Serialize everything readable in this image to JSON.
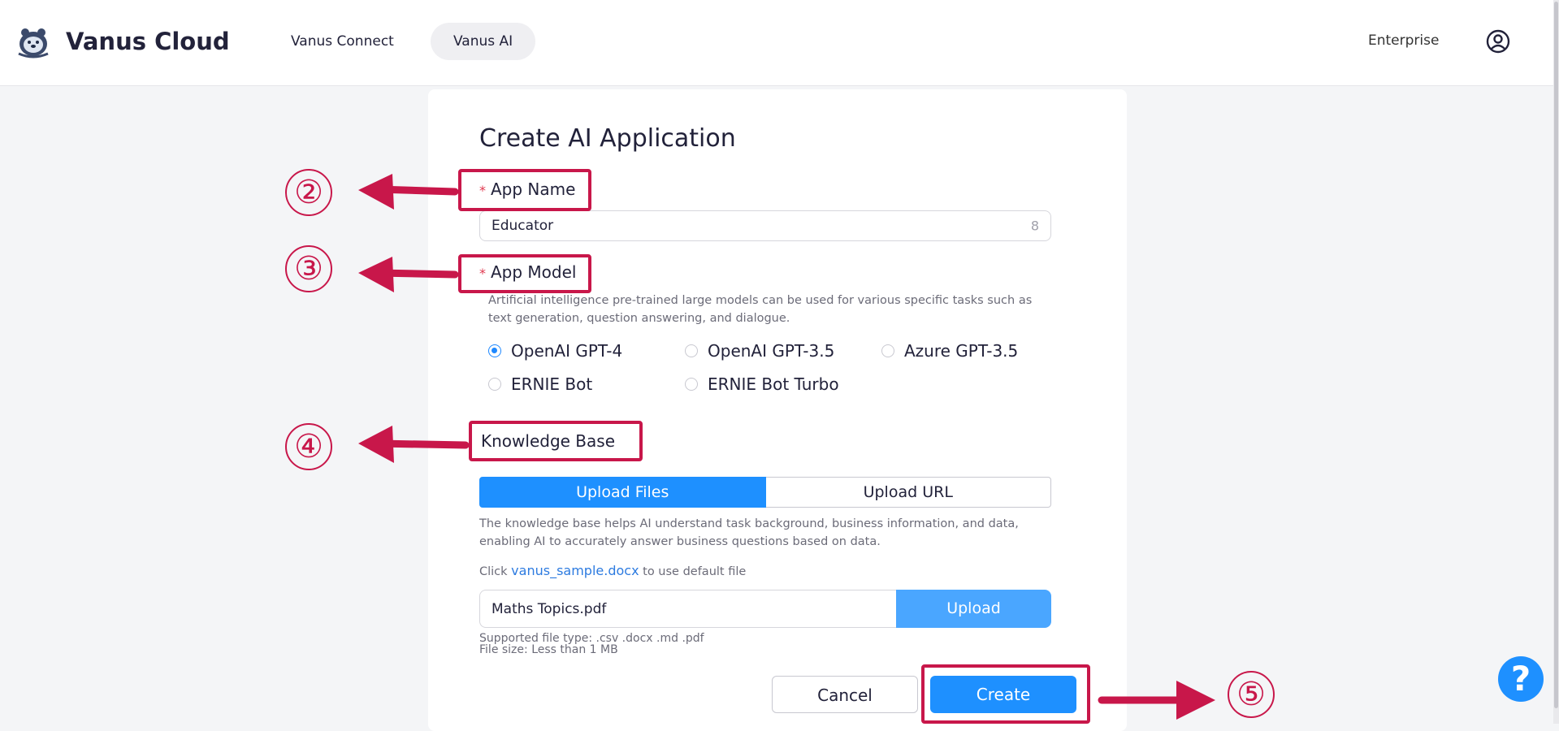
{
  "header": {
    "brand": "Vanus Cloud",
    "nav": [
      "Vanus Connect",
      "Vanus AI"
    ],
    "enterprise": "Enterprise"
  },
  "form": {
    "title": "Create AI Application",
    "app_name_label": "App Name",
    "app_name_value": "Educator",
    "app_name_count": "8",
    "app_model_label": "App Model",
    "app_model_help": "Artificial intelligence pre-trained large models can be used for various specific tasks such as text generation, question answering, and dialogue.",
    "models": [
      {
        "label": "OpenAI GPT-4",
        "checked": true
      },
      {
        "label": "OpenAI GPT-3.5",
        "checked": false
      },
      {
        "label": "Azure GPT-3.5",
        "checked": false
      },
      {
        "label": "ERNIE Bot",
        "checked": false
      },
      {
        "label": "ERNIE Bot Turbo",
        "checked": false
      }
    ],
    "kb_label": "Knowledge Base",
    "tabs": [
      "Upload Files",
      "Upload URL"
    ],
    "kb_help": "The knowledge base helps AI understand task background, business information, and data, enabling AI to accurately answer business questions based on data.",
    "sample_prefix": "Click",
    "sample_link": "vanus_sample.docx",
    "sample_suffix": "to use default file",
    "file_name": "Maths Topics.pdf",
    "upload_label": "Upload",
    "supported_types": "Supported file type: .csv .docx .md .pdf",
    "file_size": "File size: Less than 1 MB",
    "cancel_label": "Cancel",
    "create_label": "Create"
  },
  "annotations": [
    "②",
    "③",
    "④",
    "⑤"
  ],
  "help_icon": "?",
  "colors": {
    "primary": "#1e90ff",
    "upload": "#4aa6ff",
    "annotation": "#c8174a",
    "required": "#e0384f"
  }
}
